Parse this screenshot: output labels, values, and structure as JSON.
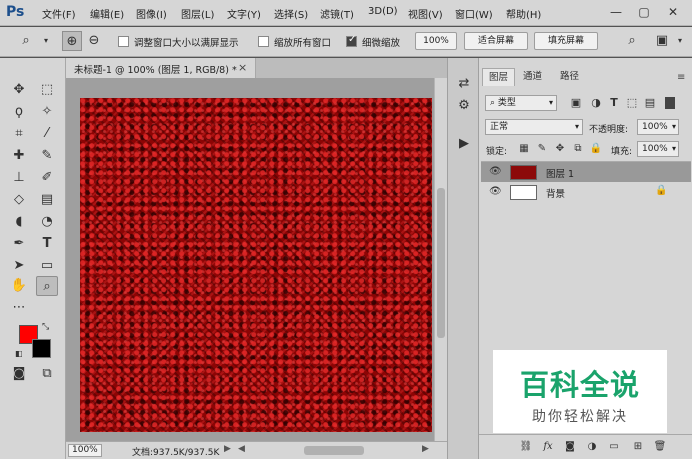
{
  "app": {
    "logo": "Ps",
    "menu": [
      "文件(F)",
      "编辑(E)",
      "图像(I)",
      "图层(L)",
      "文字(Y)",
      "选择(S)",
      "滤镜(T)",
      "3D(D)",
      "视图(V)",
      "窗口(W)",
      "帮助(H)"
    ],
    "window_controls": {
      "minimize": "—",
      "maximize": "▢",
      "close": "✕"
    }
  },
  "options": {
    "resize_windows_label": "调整窗口大小以满屏显示",
    "resize_windows_checked": false,
    "zoom_all_label": "缩放所有窗口",
    "zoom_all_checked": false,
    "scrubby_zoom_label": "细微缩放",
    "scrubby_zoom_checked": true,
    "btn_100": "100%",
    "btn_fit": "适合屏幕",
    "btn_fill": "填充屏幕"
  },
  "document": {
    "tab_title": "未标题-1 @ 100% (图层 1, RGB/8) *",
    "close": "×",
    "zoom": "100%",
    "info": "文档:937.5K/937.5K"
  },
  "layers_panel": {
    "tabs": [
      "图层",
      "通道",
      "路径"
    ],
    "active_tab": 0,
    "filter_type": "类型",
    "blend_mode": "正常",
    "opacity_label": "不透明度:",
    "opacity_value": "100%",
    "lock_label": "锁定:",
    "fill_label": "填充:",
    "fill_value": "100%",
    "layers": [
      {
        "name": "图层 1",
        "thumb_color": "#8c0a0a",
        "selected": true,
        "locked": false
      },
      {
        "name": "背景",
        "thumb_color": "#ffffff",
        "selected": false,
        "locked": true
      }
    ]
  },
  "watermark": {
    "title": "百科全说",
    "subtitle": "助你轻松解决",
    "color": "#1aa36b"
  },
  "colors": {
    "foreground": "#ff0000",
    "background": "#000000"
  }
}
